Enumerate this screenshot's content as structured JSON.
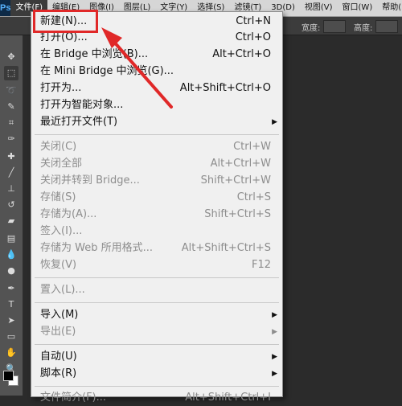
{
  "app": {
    "logo": "Ps"
  },
  "menubar": {
    "items": [
      "文件(F)",
      "编辑(E)",
      "图像(I)",
      "图层(L)",
      "文字(Y)",
      "选择(S)",
      "滤镜(T)",
      "3D(D)",
      "视图(V)",
      "窗口(W)",
      "帮助(H)"
    ]
  },
  "options": {
    "width_label": "宽度:",
    "height_label": "高度:"
  },
  "file_menu": {
    "new": {
      "label": "新建(N)...",
      "shortcut": "Ctrl+N"
    },
    "open": {
      "label": "打开(O)...",
      "shortcut": "Ctrl+O"
    },
    "browse_bridge": {
      "label": "在 Bridge 中浏览(B)...",
      "shortcut": "Alt+Ctrl+O"
    },
    "browse_mini_bridge": {
      "label": "在 Mini Bridge 中浏览(G)...",
      "shortcut": ""
    },
    "open_as": {
      "label": "打开为...",
      "shortcut": "Alt+Shift+Ctrl+O"
    },
    "open_smart": {
      "label": "打开为智能对象...",
      "shortcut": ""
    },
    "recent": {
      "label": "最近打开文件(T)",
      "shortcut": ""
    },
    "close": {
      "label": "关闭(C)",
      "shortcut": "Ctrl+W"
    },
    "close_all": {
      "label": "关闭全部",
      "shortcut": "Alt+Ctrl+W"
    },
    "close_to_bridge": {
      "label": "关闭并转到 Bridge...",
      "shortcut": "Shift+Ctrl+W"
    },
    "save": {
      "label": "存储(S)",
      "shortcut": "Ctrl+S"
    },
    "save_as": {
      "label": "存储为(A)...",
      "shortcut": "Shift+Ctrl+S"
    },
    "check_in": {
      "label": "签入(I)...",
      "shortcut": ""
    },
    "save_for_web": {
      "label": "存储为 Web 所用格式...",
      "shortcut": "Alt+Shift+Ctrl+S"
    },
    "revert": {
      "label": "恢复(V)",
      "shortcut": "F12"
    },
    "place": {
      "label": "置入(L)...",
      "shortcut": ""
    },
    "import": {
      "label": "导入(M)",
      "shortcut": ""
    },
    "export": {
      "label": "导出(E)",
      "shortcut": ""
    },
    "automate": {
      "label": "自动(U)",
      "shortcut": ""
    },
    "scripts": {
      "label": "脚本(R)",
      "shortcut": ""
    },
    "file_info": {
      "label": "文件简介(F)...",
      "shortcut": "Alt+Shift+Ctrl+I"
    }
  },
  "annotation": {
    "color": "#e02828"
  }
}
